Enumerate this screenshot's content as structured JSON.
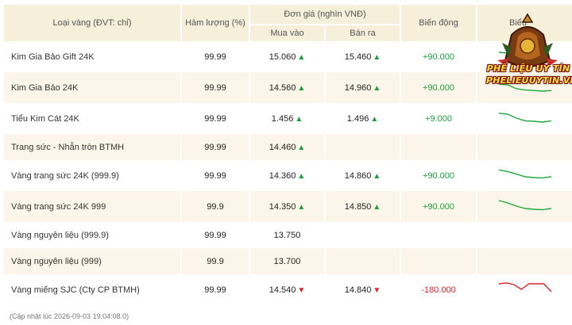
{
  "header": {
    "col_name": "Loại vàng (ĐVT: chỉ)",
    "col_purity": "Hàm lượng (%)",
    "col_price": "Đơn giá (nghìn VNĐ)",
    "col_buy": "Mua vào",
    "col_sell": "Bán ra",
    "col_change": "Biến động",
    "col_chart": "Biểu"
  },
  "rows": [
    {
      "name": "Kim Gia Bảo Gift 24K",
      "purity": "99.99",
      "buy": "15.060",
      "buy_trend": "up",
      "sell": "15.460",
      "sell_trend": "up",
      "change": "+90.000",
      "change_dir": "up",
      "spark": [
        0.2,
        0.25,
        0.55,
        0.6,
        0.65,
        0.68,
        0.64
      ],
      "spark_color": "#20a83e"
    },
    {
      "name": "Kim Gia Bảo 24K",
      "purity": "99.99",
      "buy": "14.560",
      "buy_trend": "up",
      "sell": "14.960",
      "sell_trend": "up",
      "change": "+90.000",
      "change_dir": "up",
      "spark": [
        0.25,
        0.3,
        0.55,
        0.62,
        0.66,
        0.7,
        0.66
      ],
      "spark_color": "#20a83e"
    },
    {
      "name": "Tiểu Kim Cát 24K",
      "purity": "99.99",
      "buy": "1.456",
      "buy_trend": "up",
      "sell": "1.496",
      "sell_trend": "up",
      "change": "+9.000",
      "change_dir": "up",
      "spark": [
        0.15,
        0.2,
        0.45,
        0.62,
        0.65,
        0.7,
        0.62
      ],
      "spark_color": "#20a83e"
    },
    {
      "name": "Trang sức - Nhẫn tròn BTMH",
      "purity": "99.99",
      "buy": "14.460",
      "buy_trend": "up",
      "sell": "",
      "sell_trend": "",
      "change": "",
      "change_dir": "",
      "spark": [],
      "spark_color": "#20a83e"
    },
    {
      "name": "Vàng trang sức 24K (999.9)",
      "purity": "99.99",
      "buy": "14.360",
      "buy_trend": "up",
      "sell": "14.860",
      "sell_trend": "up",
      "change": "+90.000",
      "change_dir": "up",
      "spark": [
        0.12,
        0.22,
        0.38,
        0.55,
        0.6,
        0.62,
        0.55
      ],
      "spark_color": "#20a83e"
    },
    {
      "name": "Vàng trang sức 24K 999",
      "purity": "99.9",
      "buy": "14.350",
      "buy_trend": "up",
      "sell": "14.850",
      "sell_trend": "up",
      "change": "+90.000",
      "change_dir": "up",
      "spark": [
        0.1,
        0.25,
        0.45,
        0.6,
        0.65,
        0.68,
        0.6
      ],
      "spark_color": "#20a83e"
    },
    {
      "name": "Vàng nguyên liệu (999.9)",
      "purity": "99.99",
      "buy": "13.750",
      "buy_trend": "",
      "sell": "",
      "sell_trend": "",
      "change": "",
      "change_dir": "",
      "spark": [],
      "spark_color": "#20a83e"
    },
    {
      "name": "Vàng nguyên liệu (999)",
      "purity": "99.9",
      "buy": "13.700",
      "buy_trend": "",
      "sell": "",
      "sell_trend": "",
      "change": "",
      "change_dir": "",
      "spark": [],
      "spark_color": "#20a83e"
    },
    {
      "name": "Vàng miếng SJC (Cty CP BTMH)",
      "purity": "99.99",
      "buy": "14.540",
      "buy_trend": "down",
      "sell": "14.840",
      "sell_trend": "down",
      "change": "-180.000",
      "change_dir": "down",
      "spark": [
        0.1,
        0.05,
        0.15,
        0.45,
        0.1,
        0.1,
        0.1,
        0.6
      ],
      "spark_color": "#d9252c"
    }
  ],
  "footnote": "(Cập nhật lúc 2026-09-03 19:04:08.0)",
  "watermark": {
    "line1": "PHẾ LIỆU UY TÍN",
    "line2": "PHELIEUUYTIN.VN"
  },
  "colors": {
    "header_bg": "#f6efd9",
    "row_alt_bg": "#fbf6e9",
    "up": "#1e9e3a",
    "down": "#d9252c"
  }
}
